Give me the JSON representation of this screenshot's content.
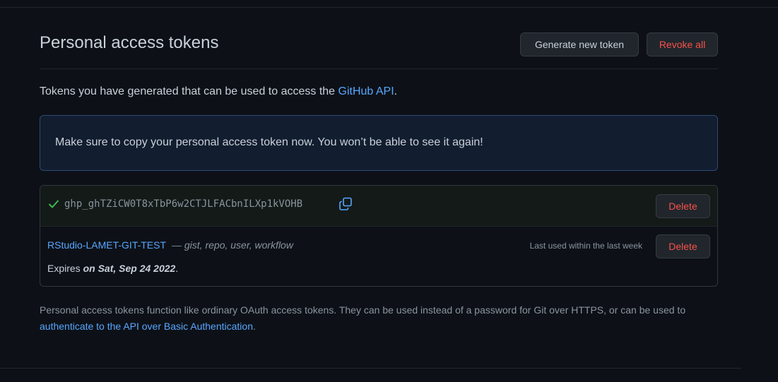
{
  "page": {
    "title": "Personal access tokens"
  },
  "header": {
    "generate_label": "Generate new token",
    "revoke_label": "Revoke all"
  },
  "intro": {
    "text_before": "Tokens you have generated that can be used to access the ",
    "link_text": "GitHub API",
    "text_after": "."
  },
  "flash": {
    "message": "Make sure to copy your personal access token now. You won’t be able to see it again!"
  },
  "new_token": {
    "value": "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",
    "delete_label": "Delete",
    "icons": {
      "status": "check-icon",
      "copy": "copy-icon"
    }
  },
  "token": {
    "name": "RStudio-LAMET-GIT-TEST",
    "scopes": "— gist, repo, user, workflow",
    "last_used": "Last used within the last week",
    "delete_label": "Delete",
    "expires_prefix": "Expires ",
    "expires_date": "on Sat, Sep 24 2022",
    "expires_suffix": "."
  },
  "footer": {
    "text": "Personal access tokens function like ordinary OAuth access tokens. They can be used instead of a password for Git over HTTPS, or can be used to ",
    "link_text": "authenticate to the API over Basic Authentication",
    "text_after": "."
  },
  "colors": {
    "background": "#0d1117",
    "link": "#58a6ff",
    "danger": "#f85149",
    "success": "#3fb950",
    "flash_bg": "#121d2f",
    "flash_border": "#2d4a74"
  }
}
